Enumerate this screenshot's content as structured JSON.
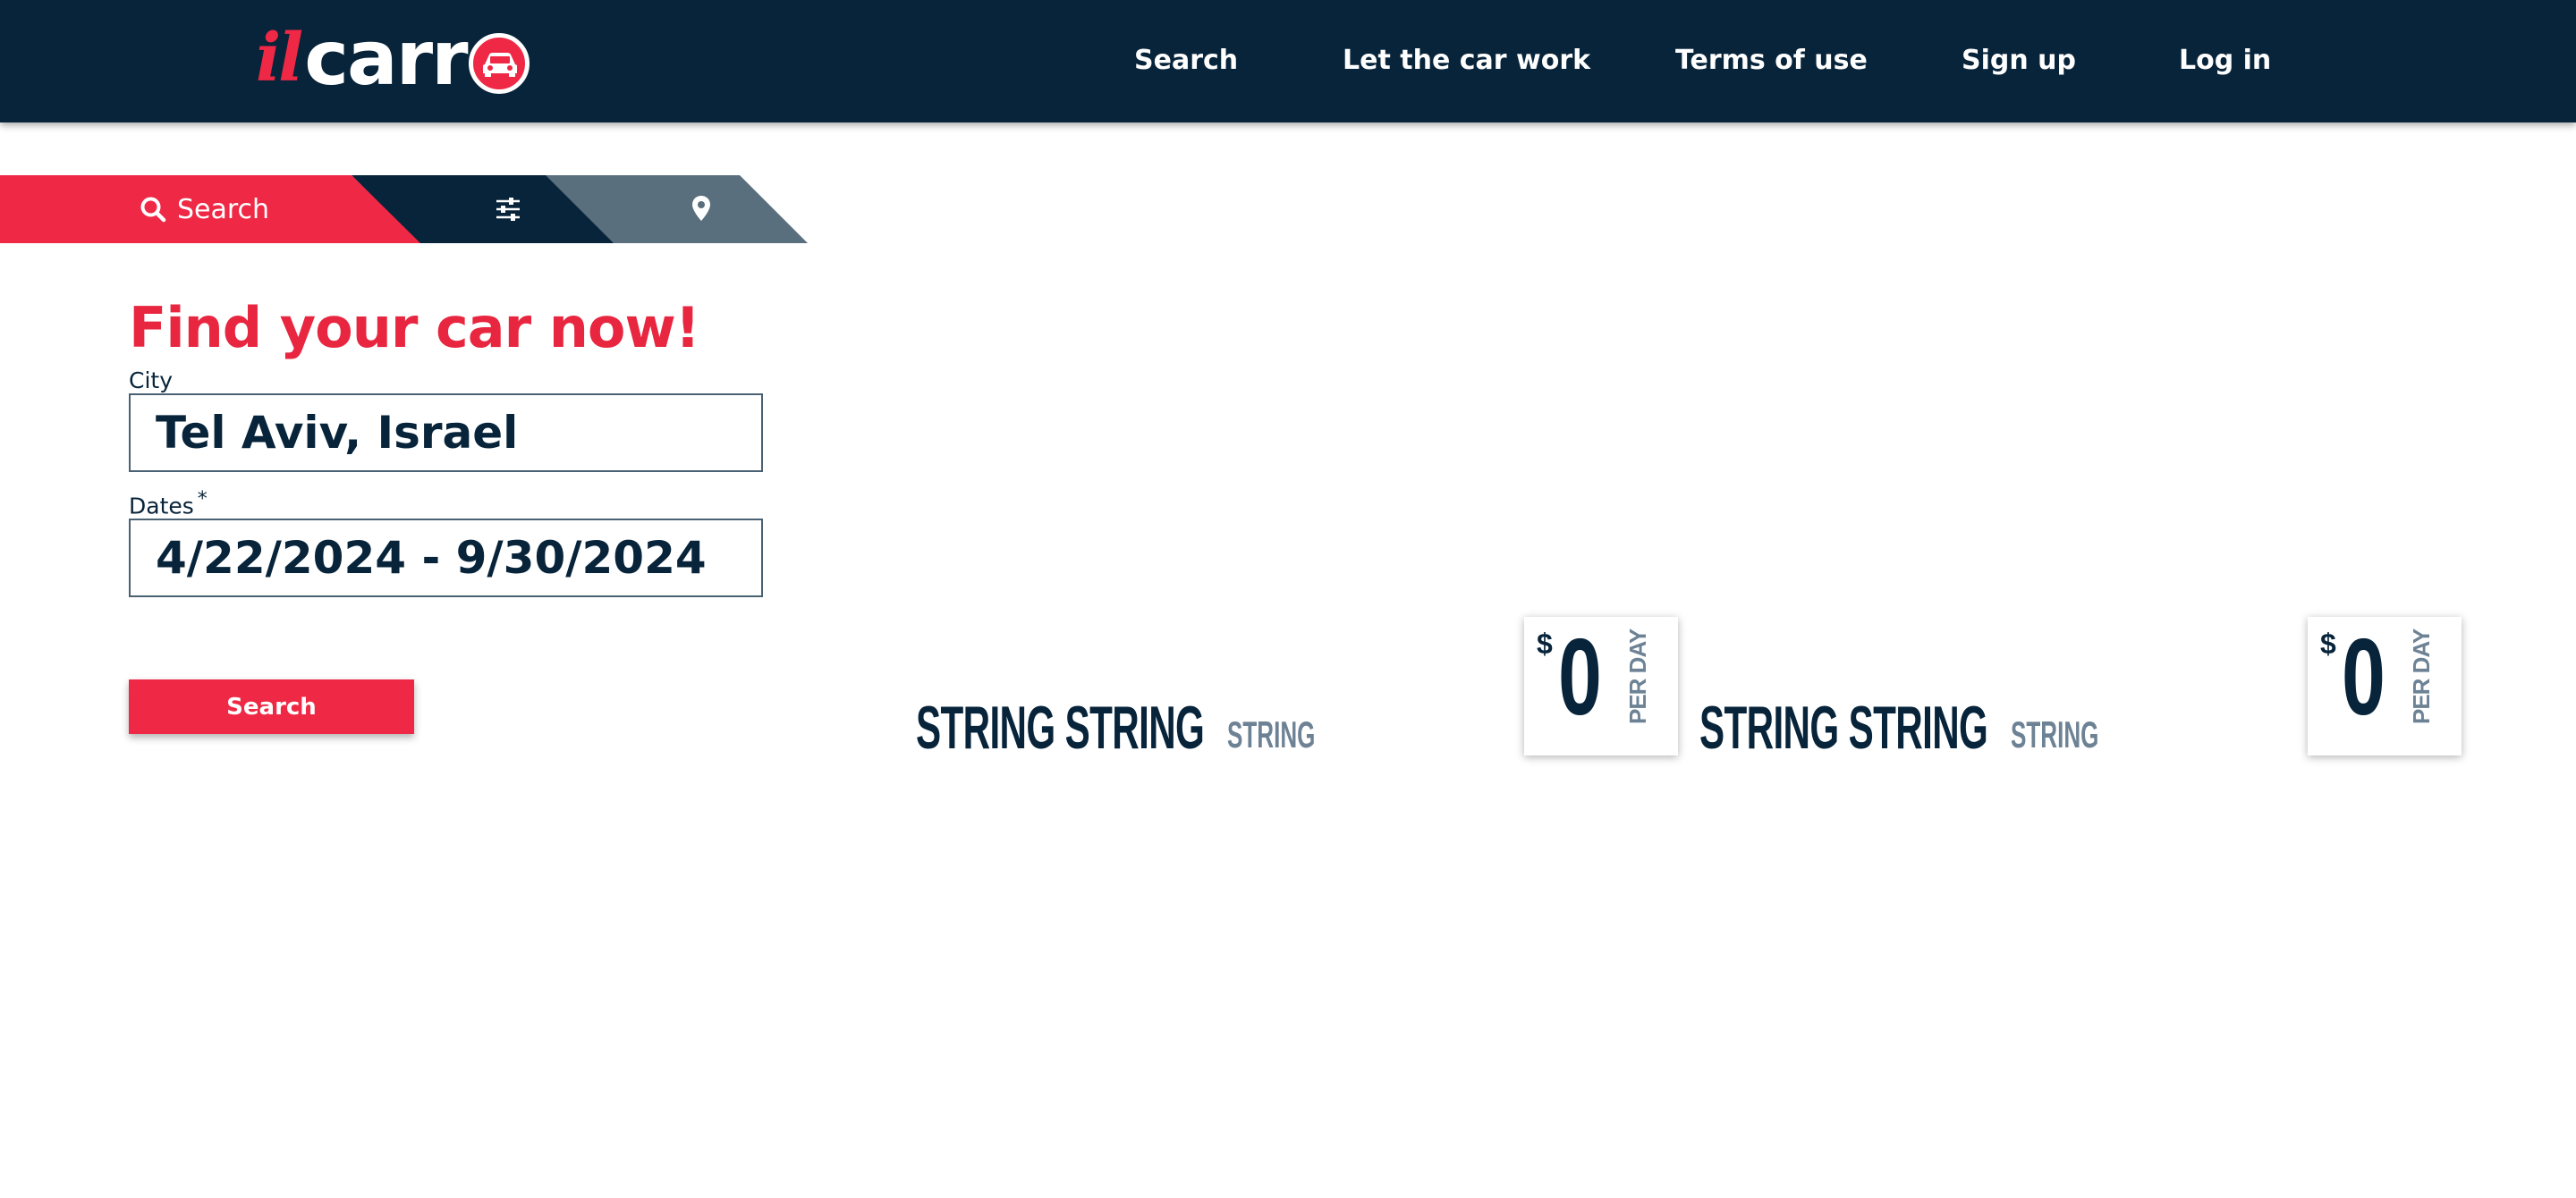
{
  "header": {
    "logo": {
      "prefix": "il",
      "main": "carr"
    },
    "nav": [
      {
        "label": "Search"
      },
      {
        "label": "Let the car work"
      },
      {
        "label": "Terms of use"
      },
      {
        "label": "Sign up"
      },
      {
        "label": "Log in"
      }
    ]
  },
  "tabs": {
    "search_label": "Search",
    "search_icon": "search-icon",
    "filter_icon": "sliders-icon",
    "map_icon": "map-pin-icon"
  },
  "form": {
    "title": "Find your car now!",
    "city_label": "City",
    "city_value": "Tel Aviv, Israel",
    "dates_label": "Dates",
    "dates_required_mark": "*",
    "dates_value": "4/22/2024 - 9/30/2024",
    "submit_label": "Search"
  },
  "cars": [
    {
      "title": "STRING STRING",
      "subtitle": "STRING",
      "currency": "$",
      "price": "0",
      "per": "PER DAY"
    },
    {
      "title": "STRING STRING",
      "subtitle": "STRING",
      "currency": "$",
      "price": "0",
      "per": "PER DAY"
    }
  ],
  "colors": {
    "navy": "#08243a",
    "accent_red": "#ef2845",
    "slate": "#5a6f7e",
    "muted_text": "#6d8294"
  }
}
